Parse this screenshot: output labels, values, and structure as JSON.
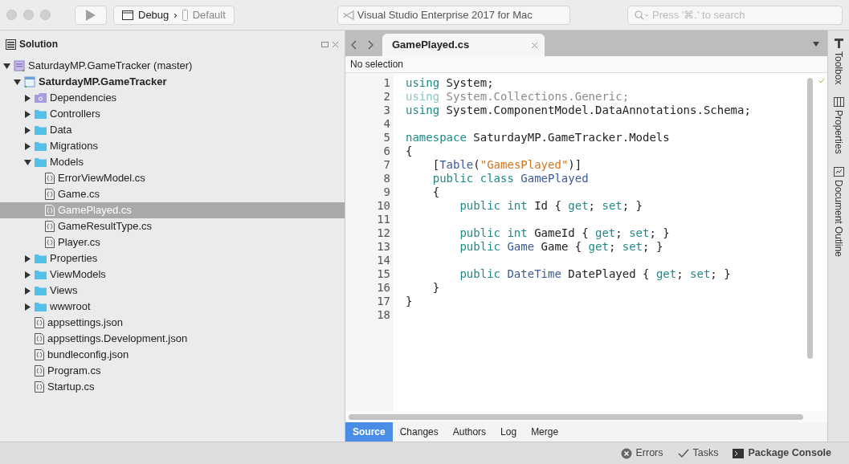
{
  "toolbar": {
    "config": "Debug",
    "separator": "›",
    "device": "Default",
    "app_title": "Visual Studio Enterprise 2017 for Mac",
    "search": {
      "placeholder": "Press '⌘.' to search"
    }
  },
  "solution_panel": {
    "title": "Solution",
    "tree": [
      {
        "label": "SaturdayMP.GameTracker (master)",
        "kind": "solution",
        "expanded": true,
        "selected": false,
        "children": [
          {
            "label": "SaturdayMP.GameTracker",
            "kind": "project",
            "expanded": true,
            "selected": false,
            "children": [
              {
                "label": "Dependencies",
                "kind": "dependencies",
                "expanded": false,
                "selected": false
              },
              {
                "label": "Controllers",
                "kind": "folder",
                "expanded": false,
                "selected": false
              },
              {
                "label": "Data",
                "kind": "folder",
                "expanded": false,
                "selected": false
              },
              {
                "label": "Migrations",
                "kind": "folder",
                "expanded": false,
                "selected": false
              },
              {
                "label": "Models",
                "kind": "folder",
                "expanded": true,
                "selected": false,
                "children": [
                  {
                    "label": "ErrorViewModel.cs",
                    "kind": "file",
                    "selected": false
                  },
                  {
                    "label": "Game.cs",
                    "kind": "file",
                    "selected": false
                  },
                  {
                    "label": "GamePlayed.cs",
                    "kind": "file",
                    "selected": true
                  },
                  {
                    "label": "GameResultType.cs",
                    "kind": "file",
                    "selected": false
                  },
                  {
                    "label": "Player.cs",
                    "kind": "file",
                    "selected": false
                  }
                ]
              },
              {
                "label": "Properties",
                "kind": "folder",
                "expanded": false,
                "selected": false
              },
              {
                "label": "ViewModels",
                "kind": "folder",
                "expanded": false,
                "selected": false
              },
              {
                "label": "Views",
                "kind": "folder",
                "expanded": false,
                "selected": false
              },
              {
                "label": "wwwroot",
                "kind": "folder",
                "expanded": false,
                "selected": false
              },
              {
                "label": "appsettings.json",
                "kind": "file",
                "selected": false
              },
              {
                "label": "appsettings.Development.json",
                "kind": "file",
                "selected": false
              },
              {
                "label": "bundleconfig.json",
                "kind": "file",
                "selected": false
              },
              {
                "label": "Program.cs",
                "kind": "file",
                "selected": false
              },
              {
                "label": "Startup.cs",
                "kind": "file",
                "selected": false
              }
            ]
          }
        ]
      }
    ]
  },
  "editor": {
    "tabs": [
      {
        "label": "GamePlayed.cs",
        "selected": true
      }
    ],
    "breadcrumb": "No selection",
    "lines": [
      {
        "number": "1",
        "dimmed": false,
        "tokens": [
          {
            "text": "using",
            "kind": "keyword"
          },
          {
            "text": " System;",
            "kind": "plain"
          }
        ]
      },
      {
        "number": "2",
        "dimmed": true,
        "tokens": [
          {
            "text": "using",
            "kind": "keyword"
          },
          {
            "text": " System.Collections.Generic;",
            "kind": "plain"
          }
        ]
      },
      {
        "number": "3",
        "dimmed": false,
        "tokens": [
          {
            "text": "using",
            "kind": "keyword"
          },
          {
            "text": " System.ComponentModel.DataAnnotations.Schema;",
            "kind": "plain"
          }
        ]
      },
      {
        "number": "4"
      },
      {
        "number": "5",
        "dimmed": false,
        "tokens": [
          {
            "text": "namespace",
            "kind": "keyword"
          },
          {
            "text": " SaturdayMP.GameTracker.Models",
            "kind": "plain"
          }
        ]
      },
      {
        "number": "6",
        "dimmed": false,
        "tokens": [
          {
            "text": "{",
            "kind": "plain"
          }
        ]
      },
      {
        "number": "7",
        "dimmed": false,
        "tokens": [
          {
            "text": "    [",
            "kind": "plain"
          },
          {
            "text": "Table",
            "kind": "type"
          },
          {
            "text": "(",
            "kind": "plain"
          },
          {
            "text": "\"GamesPlayed\"",
            "kind": "string"
          },
          {
            "text": ")]",
            "kind": "plain"
          }
        ]
      },
      {
        "number": "8",
        "dimmed": false,
        "tokens": [
          {
            "text": "    public class",
            "kind": "keyword"
          },
          {
            "text": " GamePlayed",
            "kind": "type"
          }
        ]
      },
      {
        "number": "9",
        "dimmed": false,
        "tokens": [
          {
            "text": "    {",
            "kind": "plain"
          }
        ]
      },
      {
        "number": "10",
        "dimmed": false,
        "tokens": [
          {
            "text": "        public int",
            "kind": "keyword"
          },
          {
            "text": " Id { ",
            "kind": "plain"
          },
          {
            "text": "get",
            "kind": "keyword"
          },
          {
            "text": "; ",
            "kind": "plain"
          },
          {
            "text": "set",
            "kind": "keyword"
          },
          {
            "text": "; }",
            "kind": "plain"
          }
        ]
      },
      {
        "number": "11"
      },
      {
        "number": "12",
        "dimmed": false,
        "tokens": [
          {
            "text": "        public int",
            "kind": "keyword"
          },
          {
            "text": " GameId { ",
            "kind": "plain"
          },
          {
            "text": "get",
            "kind": "keyword"
          },
          {
            "text": "; ",
            "kind": "plain"
          },
          {
            "text": "set",
            "kind": "keyword"
          },
          {
            "text": "; }",
            "kind": "plain"
          }
        ]
      },
      {
        "number": "13",
        "dimmed": false,
        "tokens": [
          {
            "text": "        public",
            "kind": "keyword"
          },
          {
            "text": " Game",
            "kind": "type"
          },
          {
            "text": " Game { ",
            "kind": "plain"
          },
          {
            "text": "get",
            "kind": "keyword"
          },
          {
            "text": "; ",
            "kind": "plain"
          },
          {
            "text": "set",
            "kind": "keyword"
          },
          {
            "text": "; }",
            "kind": "plain"
          }
        ]
      },
      {
        "number": "14"
      },
      {
        "number": "15",
        "dimmed": false,
        "tokens": [
          {
            "text": "        public",
            "kind": "keyword"
          },
          {
            "text": " DateTime",
            "kind": "type"
          },
          {
            "text": " DatePlayed { ",
            "kind": "plain"
          },
          {
            "text": "get",
            "kind": "keyword"
          },
          {
            "text": "; ",
            "kind": "plain"
          },
          {
            "text": "set",
            "kind": "keyword"
          },
          {
            "text": "; }",
            "kind": "plain"
          }
        ]
      },
      {
        "number": "16",
        "dimmed": false,
        "tokens": [
          {
            "text": "    }",
            "kind": "plain"
          }
        ]
      },
      {
        "number": "17",
        "dimmed": false,
        "tokens": [
          {
            "text": "}",
            "kind": "plain"
          }
        ]
      },
      {
        "number": "18"
      }
    ],
    "bottom_tabs": [
      {
        "label": "Source",
        "selected": true
      },
      {
        "label": "Changes",
        "selected": false
      },
      {
        "label": "Authors",
        "selected": false
      },
      {
        "label": "Log",
        "selected": false
      },
      {
        "label": "Merge",
        "selected": false
      }
    ]
  },
  "side_pads": [
    {
      "label": "Toolbox",
      "kind": "toolbox"
    },
    {
      "label": "Properties",
      "kind": "properties"
    },
    {
      "label": "Document Outline",
      "kind": "outline"
    }
  ],
  "status_bar": [
    {
      "label": "Errors",
      "kind": "errors"
    },
    {
      "label": "Tasks",
      "kind": "tasks"
    },
    {
      "label": "Package Console",
      "kind": "console"
    }
  ]
}
